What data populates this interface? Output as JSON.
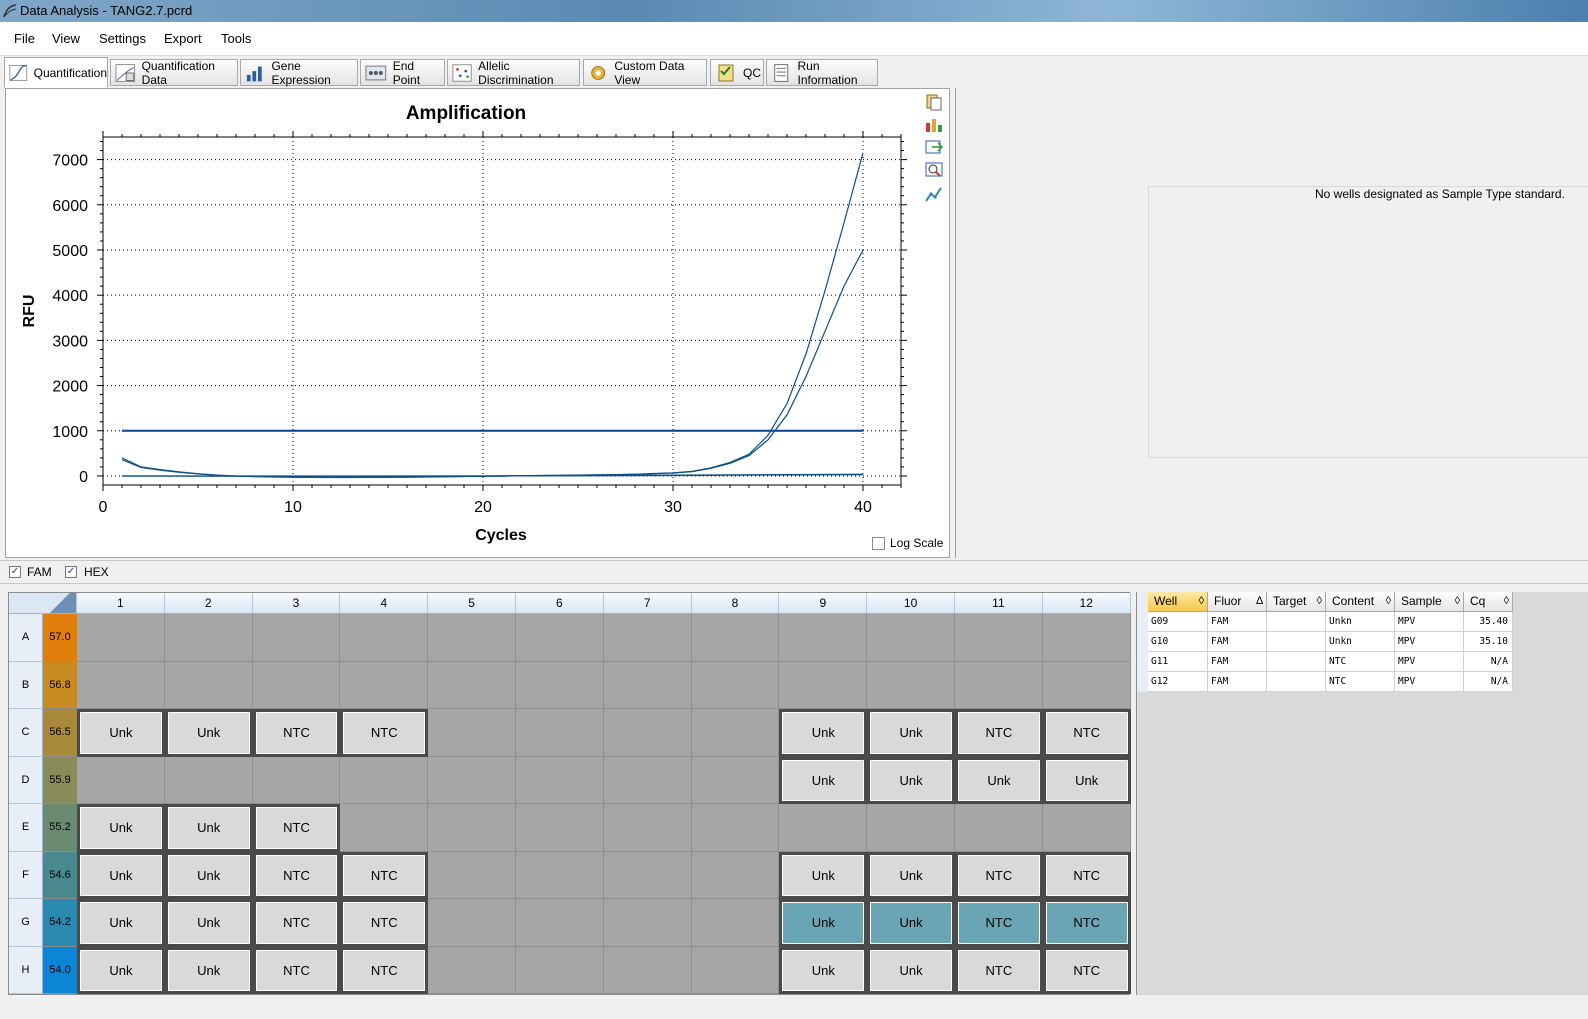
{
  "window": {
    "title": "Data Analysis - TANG2.7.pcrd"
  },
  "menu": [
    "File",
    "View",
    "Settings",
    "Export",
    "Tools"
  ],
  "tabs": [
    "Quantification",
    "Quantification Data",
    "Gene Expression",
    "End Point",
    "Allelic Discrimination",
    "Custom Data View",
    "QC",
    "Run Information"
  ],
  "chart_data": {
    "type": "line",
    "title": "Amplification",
    "xlabel": "Cycles",
    "ylabel": "RFU",
    "xlim": [
      0,
      42
    ],
    "ylim": [
      -200,
      7500
    ],
    "xticks": [
      0,
      10,
      20,
      30,
      40
    ],
    "yticks": [
      0,
      1000,
      2000,
      3000,
      4000,
      5000,
      6000,
      7000
    ],
    "grid": true,
    "threshold": {
      "x": [
        1,
        40
      ],
      "y": [
        1000,
        1000
      ]
    },
    "series": [
      {
        "x": [
          1,
          2,
          3,
          4,
          5,
          6,
          7,
          8,
          9,
          10,
          11,
          12,
          13,
          14,
          15,
          16,
          17,
          18,
          19,
          20,
          21,
          22,
          23,
          24,
          25,
          26,
          27,
          28,
          29,
          30,
          31,
          32,
          33,
          34,
          35,
          36,
          37,
          38,
          39,
          40
        ],
        "y": [
          400,
          200,
          140,
          90,
          50,
          20,
          0,
          -10,
          -20,
          -25,
          -30,
          -30,
          -30,
          -30,
          -28,
          -25,
          -20,
          -15,
          -10,
          -5,
          0,
          5,
          10,
          15,
          20,
          25,
          30,
          40,
          55,
          70,
          100,
          180,
          300,
          480,
          900,
          1600,
          2700,
          4100,
          5600,
          7150
        ]
      },
      {
        "x": [
          1,
          2,
          3,
          4,
          5,
          6,
          7,
          8,
          9,
          10,
          11,
          12,
          13,
          14,
          15,
          16,
          17,
          18,
          19,
          20,
          21,
          22,
          23,
          24,
          25,
          26,
          27,
          28,
          29,
          30,
          31,
          32,
          33,
          34,
          35,
          36,
          37,
          38,
          39,
          40
        ],
        "y": [
          360,
          190,
          130,
          80,
          45,
          15,
          -5,
          -15,
          -22,
          -28,
          -32,
          -33,
          -33,
          -32,
          -30,
          -27,
          -22,
          -18,
          -12,
          -7,
          -2,
          3,
          8,
          12,
          18,
          22,
          28,
          36,
          50,
          65,
          95,
          170,
          280,
          450,
          800,
          1350,
          2200,
          3200,
          4200,
          5000
        ]
      },
      {
        "x": [
          1,
          10,
          20,
          30,
          40
        ],
        "y": [
          0,
          0,
          0,
          20,
          40
        ]
      },
      {
        "x": [
          1,
          10,
          20,
          30,
          40
        ],
        "y": [
          0,
          -5,
          0,
          10,
          30
        ]
      }
    ]
  },
  "log_scale": {
    "label": "Log Scale",
    "checked": false
  },
  "fluors": [
    {
      "label": "FAM",
      "checked": true
    },
    {
      "label": "HEX",
      "checked": true
    }
  ],
  "std_message": "No wells designated as Sample Type standard.",
  "plate": {
    "cols": [
      "1",
      "2",
      "3",
      "4",
      "5",
      "6",
      "7",
      "8",
      "9",
      "10",
      "11",
      "12"
    ],
    "rows": [
      {
        "label": "A",
        "temp": "57.0",
        "color": "#e07f0c",
        "wells": [
          "",
          "",
          "",
          "",
          "",
          "",
          "",
          "",
          "",
          "",
          "",
          ""
        ]
      },
      {
        "label": "B",
        "temp": "56.8",
        "color": "#c98a22",
        "wells": [
          "",
          "",
          "",
          "",
          "",
          "",
          "",
          "",
          "",
          "",
          "",
          ""
        ]
      },
      {
        "label": "C",
        "temp": "56.5",
        "color": "#a98a3b",
        "wells": [
          "Unk",
          "Unk",
          "NTC",
          "NTC",
          "",
          "",
          "",
          "",
          "Unk",
          "Unk",
          "NTC",
          "NTC"
        ]
      },
      {
        "label": "D",
        "temp": "55.9",
        "color": "#898b5a",
        "wells": [
          "",
          "",
          "",
          "",
          "",
          "",
          "",
          "",
          "Unk",
          "Unk",
          "Unk",
          "Unk"
        ]
      },
      {
        "label": "E",
        "temp": "55.2",
        "color": "#6a8a72",
        "wells": [
          "Unk",
          "Unk",
          "NTC",
          "",
          "",
          "",
          "",
          "",
          "",
          "",
          "",
          ""
        ]
      },
      {
        "label": "F",
        "temp": "54.6",
        "color": "#4a8a8f",
        "wells": [
          "Unk",
          "Unk",
          "NTC",
          "NTC",
          "",
          "",
          "",
          "",
          "Unk",
          "Unk",
          "NTC",
          "NTC"
        ]
      },
      {
        "label": "G",
        "temp": "54.2",
        "color": "#2b8ab0",
        "wells": [
          "Unk",
          "Unk",
          "NTC",
          "NTC",
          "",
          "",
          "",
          "",
          "Unk",
          "Unk",
          "NTC",
          "NTC"
        ]
      },
      {
        "label": "H",
        "temp": "54.0",
        "color": "#0b86d6",
        "wells": [
          "Unk",
          "Unk",
          "NTC",
          "NTC",
          "",
          "",
          "",
          "",
          "Unk",
          "Unk",
          "NTC",
          "NTC"
        ]
      }
    ],
    "selected_row": "G",
    "selected_cols": [
      9,
      10,
      11,
      12
    ]
  },
  "results": {
    "headers": [
      "Well",
      "Fluor",
      "Target",
      "Content",
      "Sample",
      "Cq"
    ],
    "rows": [
      [
        "G09",
        "FAM",
        "",
        "Unkn",
        "MPV",
        "35.40"
      ],
      [
        "G10",
        "FAM",
        "",
        "Unkn",
        "MPV",
        "35.10"
      ],
      [
        "G11",
        "FAM",
        "",
        "NTC",
        "MPV",
        "N/A"
      ],
      [
        "G12",
        "FAM",
        "",
        "NTC",
        "MPV",
        "N/A"
      ]
    ]
  }
}
